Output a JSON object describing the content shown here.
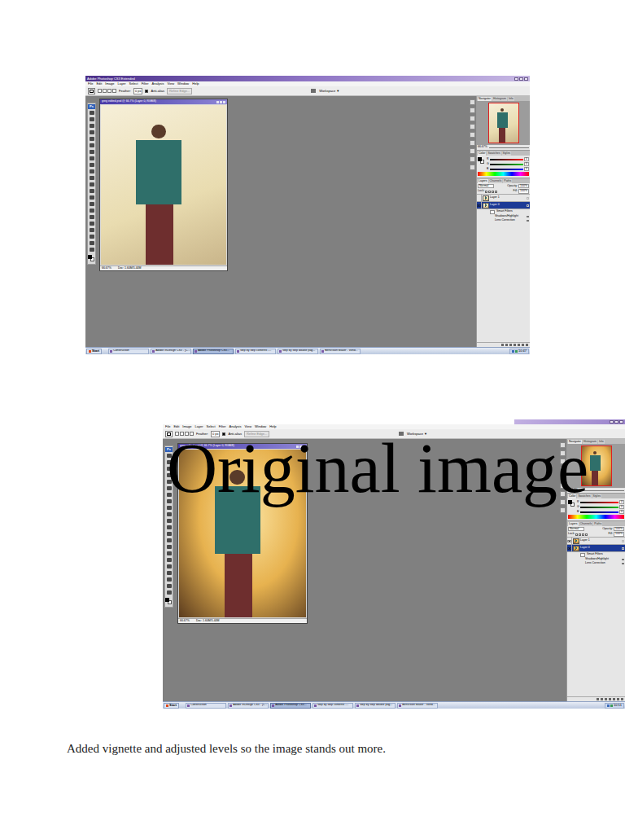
{
  "screenshots": [
    {
      "title": "Adobe Photoshop CS3 Extended",
      "menu": [
        "File",
        "Edit",
        "Image",
        "Layer",
        "Select",
        "Filter",
        "Analysis",
        "View",
        "Window",
        "Help"
      ],
      "options": {
        "feather_label": "Feather:",
        "feather_value": "0 px",
        "anti_alias": "Anti-alias",
        "anti_alias_checked": true,
        "refine": "Refine Edge...",
        "workspace": "Workspace ▼"
      },
      "toolbox_badge": "Ps",
      "document": {
        "title": "greg edited.psd @ 66.7% (Layer 0, RGB/8)",
        "zoom": "66.67%",
        "doc_size": "Doc: 1.60M/5.44M"
      },
      "navigator": {
        "tabs": [
          {
            "label": "Navigator",
            "selected": true
          },
          {
            "label": "Histogram",
            "selected": false
          },
          {
            "label": "Info",
            "selected": false
          }
        ],
        "zoom": "66.67%"
      },
      "color": {
        "tabs": [
          {
            "label": "Color",
            "selected": true
          },
          {
            "label": "Swatches",
            "selected": false
          },
          {
            "label": "Styles",
            "selected": false
          }
        ],
        "channels": [
          {
            "label": "R",
            "value": "0",
            "color": "#ff0000"
          },
          {
            "label": "G",
            "value": "0",
            "color": "#00c000"
          },
          {
            "label": "B",
            "value": "0",
            "color": "#0000ff"
          }
        ]
      },
      "layers": {
        "tabs": [
          {
            "label": "Layers",
            "selected": true
          },
          {
            "label": "Channels",
            "selected": false
          },
          {
            "label": "Paths",
            "selected": false
          }
        ],
        "blend": "Normal",
        "opacity_label": "Opacity:",
        "opacity": "100%",
        "lock_label": "Lock:",
        "fill_label": "Fill:",
        "fill": "100%",
        "items": [
          {
            "name": "Layer 1",
            "kind": "layer",
            "visible": false,
            "selected": false
          },
          {
            "name": "Layer 0",
            "kind": "layer",
            "visible": true,
            "selected": true
          },
          {
            "name": "Smart Filters",
            "kind": "group",
            "visible": true,
            "selected": false
          },
          {
            "name": "Shadows/Highlight",
            "kind": "filter",
            "visible": true,
            "selected": false
          },
          {
            "name": "Lens Correction",
            "kind": "filter",
            "visible": true,
            "selected": false
          }
        ]
      },
      "taskbar": {
        "start": "Start",
        "items": [
          {
            "label": "Construction",
            "selected": false
          },
          {
            "label": "Adobe InDesign CS3 - [C...",
            "selected": false
          },
          {
            "label": "Adobe Photoshop CS3...",
            "selected": true
          },
          {
            "label": "step by step contents -...",
            "selected": false
          },
          {
            "label": "step by step double pag...",
            "selected": false
          },
          {
            "label": "BenVision Maker - Wind...",
            "selected": false
          }
        ],
        "clock": "10:47"
      }
    },
    {
      "menu": [
        "File",
        "Edit",
        "Image",
        "Layer",
        "Select",
        "Filter",
        "Analysis",
        "View",
        "Window",
        "Help"
      ],
      "options": {
        "feather_label": "Feather:",
        "feather_value": "0 px",
        "anti_alias": "Anti-alias",
        "anti_alias_checked": true,
        "refine": "Refine Edge...",
        "workspace": "Workspace ▼"
      },
      "toolbox_badge": "Ps",
      "document": {
        "title": "greg edited.psd @ 66.7% (Layer 0, RGB/8)",
        "zoom": "66.67%",
        "doc_size": "Doc: 1.60M/5.44M"
      },
      "navigator": {
        "tabs": [
          {
            "label": "Navigator",
            "selected": true
          },
          {
            "label": "Histogram",
            "selected": false
          },
          {
            "label": "Info",
            "selected": false
          }
        ],
        "zoom": "66.67%"
      },
      "color": {
        "tabs": [
          {
            "label": "Color",
            "selected": true
          },
          {
            "label": "Swatches",
            "selected": false
          },
          {
            "label": "Styles",
            "selected": false
          }
        ],
        "channels": [
          {
            "label": "R",
            "value": "0",
            "color": "#ff0000"
          },
          {
            "label": "G",
            "value": "0",
            "color": "#00c000"
          },
          {
            "label": "B",
            "value": "0",
            "color": "#0000ff"
          }
        ]
      },
      "layers": {
        "tabs": [
          {
            "label": "Layers",
            "selected": true
          },
          {
            "label": "Channels",
            "selected": false
          },
          {
            "label": "Paths",
            "selected": false
          }
        ],
        "blend": "Normal",
        "opacity_label": "Opacity:",
        "opacity": "100%",
        "lock_label": "Lock:",
        "fill_label": "Fill:",
        "fill": "100%",
        "items": [
          {
            "name": "Layer 1",
            "kind": "layer",
            "visible": true,
            "selected": false
          },
          {
            "name": "Layer 0",
            "kind": "layer",
            "visible": true,
            "selected": true
          },
          {
            "name": "Smart Filters",
            "kind": "group",
            "visible": true,
            "selected": false
          },
          {
            "name": "Shadows/Highlight",
            "kind": "filter",
            "visible": true,
            "selected": false
          },
          {
            "name": "Lens Correction",
            "kind": "filter",
            "visible": true,
            "selected": false
          }
        ]
      },
      "taskbar": {
        "start": "Start",
        "items": [
          {
            "label": "Construction",
            "selected": false
          },
          {
            "label": "Adobe InDesign CS3 - [C...",
            "selected": false
          },
          {
            "label": "Adobe Photoshop CS3...",
            "selected": true
          },
          {
            "label": "step by step contents -...",
            "selected": false
          },
          {
            "label": "step by step double pag...",
            "selected": false
          },
          {
            "label": "BenVision Maker - Wind...",
            "selected": false
          }
        ],
        "clock": "10:51"
      }
    }
  ],
  "overlay": "Original image",
  "caption": "Added vignette and adjusted levels so the image stands out more."
}
